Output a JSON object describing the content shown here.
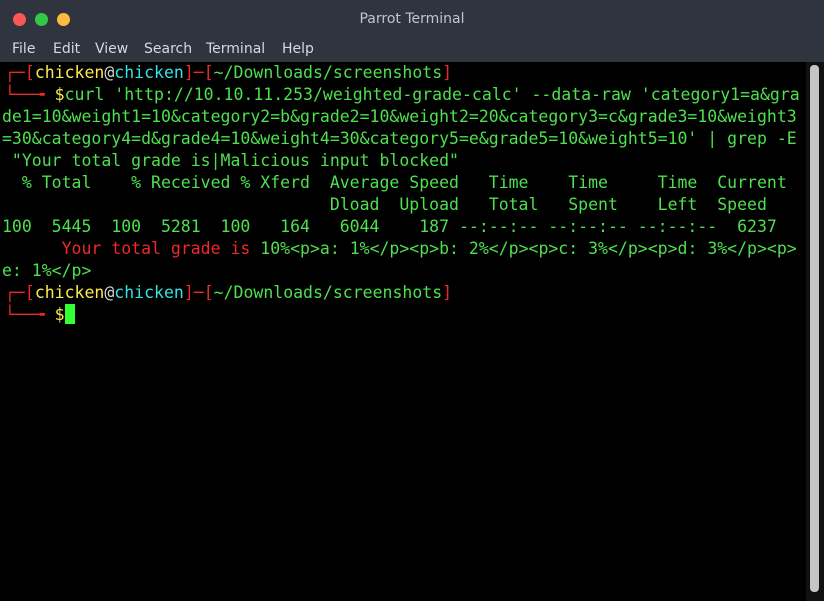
{
  "window": {
    "title": "Parrot Terminal"
  },
  "menu": [
    "File",
    "Edit",
    "View",
    "Search",
    "Terminal",
    "Help"
  ],
  "prompt": {
    "user": "chicken",
    "at": "@",
    "host": "chicken",
    "path": "~/Downloads/screenshots",
    "symbol": "$"
  },
  "output": {
    "cmd_line1": "curl 'http://10.10.11.253/weighted-grade-calc' --data-raw 'category1=a&gra",
    "cmd_line2": "de1=10&weight1=10&category2=b&grade2=10&weight2=20&category3=c&grade3=10&weight3",
    "cmd_line3": "=30&category4=d&grade4=10&weight4=30&category5=e&grade5=10&weight5=10' | grep -E",
    "cmd_line4": " \"Your total grade is|Malicious input blocked\"",
    "header1": "  % Total    % Received % Xferd  Average Speed   Time    Time     Time  Current",
    "header2": "                                 Dload  Upload   Total   Spent    Left  Speed",
    "stats": "100  5445  100  5281  100   164   6044    187 --:--:-- --:--:-- --:--:--  6237",
    "result_indent": "      ",
    "result_red": "Your total grade is",
    "result_rest1": " 10%<p>a: 1%</p><p>b: 2%</p><p>c: 3%</p><p>d: 3%</p><p>",
    "result_rest2": "e: 1%</p>"
  },
  "colors": {
    "terminal_bg": "#000000",
    "prompt_bracket": "#ef2929",
    "prompt_user": "#fce94f",
    "prompt_host": "#34e2e2",
    "output_green": "#4ee04e",
    "cursor": "#33ff33",
    "titlebar": "#2f343f"
  }
}
